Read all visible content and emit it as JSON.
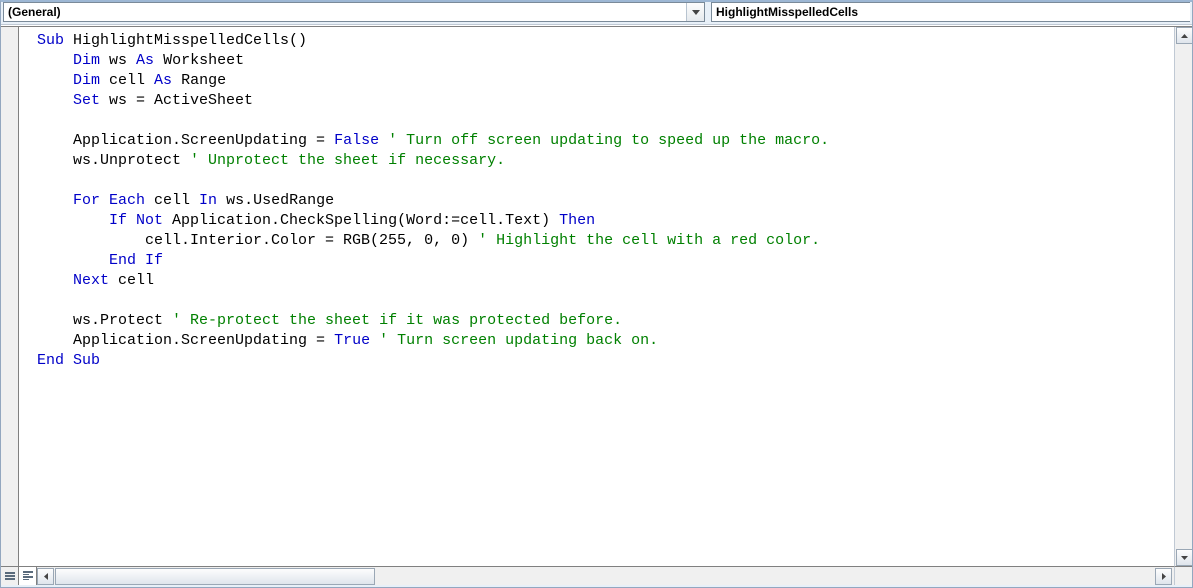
{
  "dropdowns": {
    "object": "(General)",
    "procedure": "HighlightMisspelledCells"
  },
  "code": {
    "tokens": [
      [
        {
          "t": "kw",
          "v": "Sub"
        },
        {
          "t": "p",
          "v": " HighlightMisspelledCells()"
        }
      ],
      [
        {
          "t": "p",
          "v": "    "
        },
        {
          "t": "kw",
          "v": "Dim"
        },
        {
          "t": "p",
          "v": " ws "
        },
        {
          "t": "kw",
          "v": "As"
        },
        {
          "t": "p",
          "v": " Worksheet"
        }
      ],
      [
        {
          "t": "p",
          "v": "    "
        },
        {
          "t": "kw",
          "v": "Dim"
        },
        {
          "t": "p",
          "v": " cell "
        },
        {
          "t": "kw",
          "v": "As"
        },
        {
          "t": "p",
          "v": " Range"
        }
      ],
      [
        {
          "t": "p",
          "v": "    "
        },
        {
          "t": "kw",
          "v": "Set"
        },
        {
          "t": "p",
          "v": " ws = ActiveSheet"
        }
      ],
      [],
      [
        {
          "t": "p",
          "v": "    Application.ScreenUpdating = "
        },
        {
          "t": "kw",
          "v": "False"
        },
        {
          "t": "p",
          "v": " "
        },
        {
          "t": "cm",
          "v": "' Turn off screen updating to speed up the macro."
        }
      ],
      [
        {
          "t": "p",
          "v": "    ws.Unprotect "
        },
        {
          "t": "cm",
          "v": "' Unprotect the sheet if necessary."
        }
      ],
      [],
      [
        {
          "t": "p",
          "v": "    "
        },
        {
          "t": "kw",
          "v": "For Each"
        },
        {
          "t": "p",
          "v": " cell "
        },
        {
          "t": "kw",
          "v": "In"
        },
        {
          "t": "p",
          "v": " ws.UsedRange"
        }
      ],
      [
        {
          "t": "p",
          "v": "        "
        },
        {
          "t": "kw",
          "v": "If Not"
        },
        {
          "t": "p",
          "v": " Application.CheckSpelling(Word:=cell.Text) "
        },
        {
          "t": "kw",
          "v": "Then"
        }
      ],
      [
        {
          "t": "p",
          "v": "            cell.Interior.Color = RGB(255, 0, 0) "
        },
        {
          "t": "cm",
          "v": "' Highlight the cell with a red color."
        }
      ],
      [
        {
          "t": "p",
          "v": "        "
        },
        {
          "t": "kw",
          "v": "End If"
        }
      ],
      [
        {
          "t": "p",
          "v": "    "
        },
        {
          "t": "kw",
          "v": "Next"
        },
        {
          "t": "p",
          "v": " cell"
        }
      ],
      [],
      [
        {
          "t": "p",
          "v": "    ws.Protect "
        },
        {
          "t": "cm",
          "v": "' Re-protect the sheet if it was protected before."
        }
      ],
      [
        {
          "t": "p",
          "v": "    Application.ScreenUpdating = "
        },
        {
          "t": "kw",
          "v": "True"
        },
        {
          "t": "p",
          "v": " "
        },
        {
          "t": "cm",
          "v": "' Turn screen updating back on."
        }
      ],
      [
        {
          "t": "kw",
          "v": "End Sub"
        }
      ]
    ]
  }
}
